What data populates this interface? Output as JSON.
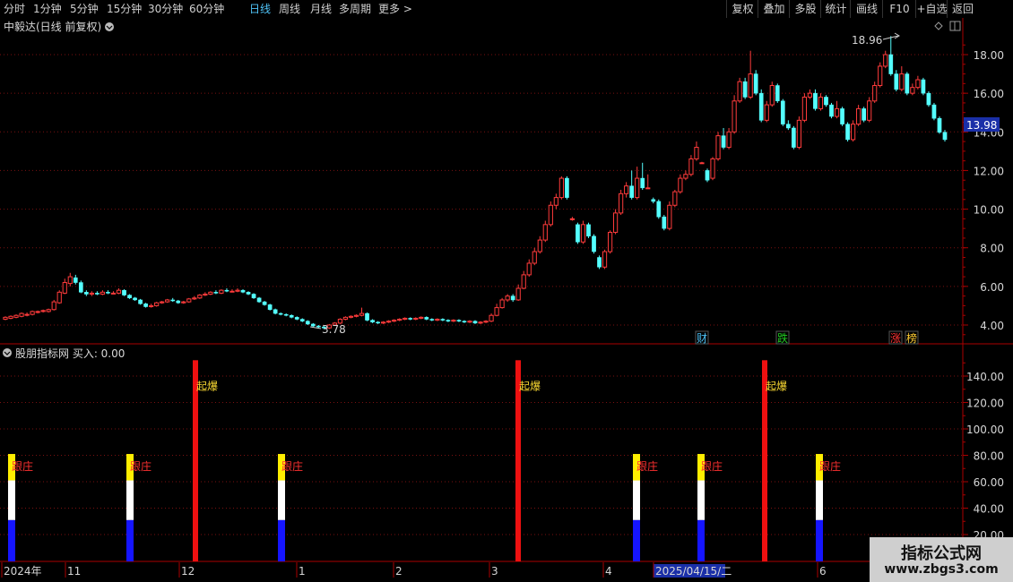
{
  "toolbar": {
    "periods": [
      "分时",
      "1分钟",
      "5分钟",
      "15分钟",
      "30分钟",
      "60分钟",
      "日线",
      "周线",
      "月线",
      "多周期",
      "更多 >"
    ],
    "active_period": "日线",
    "right_buttons": [
      "复权",
      "叠加",
      "多股",
      "统计",
      "画线",
      "F10",
      "+自选",
      "返回"
    ]
  },
  "main_panel": {
    "title": "中毅达(日线 前复权)",
    "high_label": "18.96",
    "low_label": "3.78",
    "current_price": "13.98",
    "y_ticks": [
      "18.00",
      "16.00",
      "14.00",
      "12.00",
      "10.00",
      "8.00",
      "6.00",
      "4.00"
    ],
    "event_tags": [
      {
        "text": "财",
        "color": "#4fc3f7"
      },
      {
        "text": "跌",
        "color": "#22cc22"
      },
      {
        "text": "涨",
        "color": "#ff3333"
      },
      {
        "text": "榜",
        "color": "#ffcc33"
      }
    ],
    "colors": {
      "up": "#ff3b3b",
      "down": "#54ffff",
      "grid": "#7a1111",
      "axis": "#aa0000"
    }
  },
  "indicator_panel": {
    "title": "股朋指标网 买入: 0.00",
    "y_ticks": [
      "140.00",
      "120.00",
      "100.00",
      "80.00",
      "60.00",
      "40.00",
      "20.00"
    ],
    "signal_labels": {
      "short": "跟庄",
      "tall": "起爆"
    }
  },
  "time_axis": {
    "labels": [
      "2024年",
      "11",
      "12",
      "1",
      "2",
      "3",
      "4",
      "2025/04/15/二",
      "6"
    ]
  },
  "chart_data": {
    "type": "candlestick",
    "y_range": [
      3.2,
      19.5
    ],
    "candles": [
      [
        4.3,
        4.4,
        4.25,
        4.45
      ],
      [
        4.35,
        4.45,
        4.3,
        4.5
      ],
      [
        4.4,
        4.5,
        4.35,
        4.55
      ],
      [
        4.45,
        4.6,
        4.4,
        4.65
      ],
      [
        4.55,
        4.55,
        4.45,
        4.65
      ],
      [
        4.55,
        4.7,
        4.5,
        4.75
      ],
      [
        4.65,
        4.7,
        4.6,
        4.75
      ],
      [
        4.7,
        4.75,
        4.65,
        4.8
      ],
      [
        4.7,
        4.8,
        4.65,
        4.85
      ],
      [
        4.8,
        5.2,
        4.75,
        5.3
      ],
      [
        5.15,
        5.7,
        5.1,
        5.8
      ],
      [
        5.65,
        6.2,
        5.6,
        6.4
      ],
      [
        6.15,
        6.5,
        6.0,
        6.7
      ],
      [
        6.45,
        6.2,
        6.1,
        6.6
      ],
      [
        6.2,
        5.7,
        5.65,
        6.3
      ],
      [
        5.7,
        5.6,
        5.5,
        5.8
      ],
      [
        5.6,
        5.65,
        5.5,
        5.75
      ],
      [
        5.65,
        5.6,
        5.55,
        5.75
      ],
      [
        5.6,
        5.7,
        5.55,
        5.8
      ],
      [
        5.7,
        5.65,
        5.6,
        5.8
      ],
      [
        5.65,
        5.65,
        5.6,
        5.75
      ],
      [
        5.65,
        5.8,
        5.6,
        5.9
      ],
      [
        5.8,
        5.55,
        5.5,
        5.85
      ],
      [
        5.55,
        5.4,
        5.35,
        5.6
      ],
      [
        5.4,
        5.3,
        5.25,
        5.45
      ],
      [
        5.3,
        5.1,
        5.05,
        5.35
      ],
      [
        5.1,
        4.95,
        4.9,
        5.15
      ],
      [
        4.95,
        5.0,
        4.9,
        5.1
      ],
      [
        5.0,
        5.15,
        4.95,
        5.2
      ],
      [
        5.15,
        5.2,
        5.1,
        5.25
      ],
      [
        5.2,
        5.3,
        5.15,
        5.35
      ],
      [
        5.3,
        5.25,
        5.2,
        5.4
      ],
      [
        5.25,
        5.15,
        5.1,
        5.3
      ],
      [
        5.15,
        5.2,
        5.1,
        5.25
      ],
      [
        5.2,
        5.35,
        5.15,
        5.4
      ],
      [
        5.35,
        5.4,
        5.3,
        5.5
      ],
      [
        5.4,
        5.55,
        5.35,
        5.6
      ],
      [
        5.55,
        5.6,
        5.5,
        5.7
      ],
      [
        5.6,
        5.7,
        5.55,
        5.75
      ],
      [
        5.7,
        5.65,
        5.6,
        5.8
      ],
      [
        5.65,
        5.8,
        5.6,
        5.85
      ],
      [
        5.8,
        5.75,
        5.7,
        5.9
      ],
      [
        5.75,
        5.75,
        5.7,
        5.85
      ],
      [
        5.75,
        5.8,
        5.7,
        5.9
      ],
      [
        5.8,
        5.7,
        5.65,
        5.85
      ],
      [
        5.7,
        5.6,
        5.55,
        5.75
      ],
      [
        5.6,
        5.4,
        5.35,
        5.65
      ],
      [
        5.4,
        5.2,
        5.15,
        5.45
      ],
      [
        5.2,
        5.05,
        5.0,
        5.25
      ],
      [
        5.05,
        4.8,
        4.75,
        5.1
      ],
      [
        4.8,
        4.6,
        4.55,
        4.85
      ],
      [
        4.6,
        4.55,
        4.5,
        4.65
      ],
      [
        4.55,
        4.5,
        4.45,
        4.6
      ],
      [
        4.5,
        4.4,
        4.35,
        4.55
      ],
      [
        4.4,
        4.3,
        4.25,
        4.45
      ],
      [
        4.3,
        4.2,
        4.15,
        4.35
      ],
      [
        4.2,
        4.05,
        4.0,
        4.25
      ],
      [
        4.05,
        3.95,
        3.9,
        4.1
      ],
      [
        3.95,
        3.9,
        3.85,
        4.0
      ],
      [
        3.9,
        3.85,
        3.78,
        3.95
      ],
      [
        3.85,
        4.0,
        3.8,
        4.05
      ],
      [
        4.0,
        4.1,
        3.95,
        4.15
      ],
      [
        4.1,
        4.3,
        4.05,
        4.35
      ],
      [
        4.3,
        4.4,
        4.25,
        4.45
      ],
      [
        4.4,
        4.45,
        4.35,
        4.5
      ],
      [
        4.45,
        4.5,
        4.4,
        4.55
      ],
      [
        4.5,
        4.6,
        4.45,
        4.9
      ],
      [
        4.6,
        4.25,
        4.2,
        4.65
      ],
      [
        4.25,
        4.15,
        4.1,
        4.3
      ],
      [
        4.15,
        4.1,
        4.05,
        4.2
      ],
      [
        4.1,
        4.15,
        4.05,
        4.2
      ],
      [
        4.15,
        4.2,
        4.1,
        4.25
      ],
      [
        4.2,
        4.25,
        4.15,
        4.3
      ],
      [
        4.25,
        4.3,
        4.2,
        4.35
      ],
      [
        4.3,
        4.35,
        4.25,
        4.4
      ],
      [
        4.35,
        4.3,
        4.25,
        4.4
      ],
      [
        4.3,
        4.35,
        4.25,
        4.4
      ],
      [
        4.35,
        4.4,
        4.3,
        4.45
      ],
      [
        4.4,
        4.3,
        4.25,
        4.45
      ],
      [
        4.3,
        4.25,
        4.2,
        4.35
      ],
      [
        4.25,
        4.3,
        4.2,
        4.35
      ],
      [
        4.3,
        4.25,
        4.2,
        4.35
      ],
      [
        4.25,
        4.2,
        4.15,
        4.3
      ],
      [
        4.2,
        4.25,
        4.15,
        4.3
      ],
      [
        4.25,
        4.2,
        4.15,
        4.3
      ],
      [
        4.2,
        4.15,
        4.1,
        4.25
      ],
      [
        4.15,
        4.2,
        4.1,
        4.25
      ],
      [
        4.2,
        4.1,
        4.05,
        4.25
      ],
      [
        4.1,
        4.15,
        4.05,
        4.2
      ],
      [
        4.15,
        4.2,
        4.1,
        4.25
      ],
      [
        4.2,
        4.5,
        4.15,
        4.6
      ],
      [
        4.5,
        4.9,
        4.45,
        5.1
      ],
      [
        4.9,
        5.3,
        4.85,
        5.4
      ],
      [
        5.3,
        5.5,
        5.2,
        5.6
      ],
      [
        5.5,
        5.3,
        5.2,
        5.6
      ],
      [
        5.3,
        5.9,
        5.25,
        6.1
      ],
      [
        5.9,
        6.6,
        5.85,
        6.8
      ],
      [
        6.6,
        7.2,
        6.5,
        7.4
      ],
      [
        7.2,
        7.8,
        7.1,
        8.0
      ],
      [
        7.8,
        8.4,
        7.7,
        8.6
      ],
      [
        8.4,
        9.2,
        8.3,
        9.4
      ],
      [
        9.2,
        10.2,
        9.1,
        10.4
      ],
      [
        10.2,
        10.6,
        10.0,
        10.8
      ],
      [
        10.6,
        11.6,
        10.5,
        11.7
      ],
      [
        11.6,
        10.6,
        10.5,
        11.7
      ],
      [
        9.5,
        9.5,
        9.4,
        9.6
      ],
      [
        9.2,
        8.3,
        8.2,
        9.3
      ],
      [
        8.3,
        9.2,
        8.2,
        9.4
      ],
      [
        9.2,
        8.6,
        8.5,
        9.3
      ],
      [
        8.6,
        7.8,
        7.7,
        8.7
      ],
      [
        7.5,
        7.0,
        6.9,
        7.6
      ],
      [
        7.0,
        7.8,
        6.9,
        7.9
      ],
      [
        7.8,
        8.8,
        7.7,
        8.9
      ],
      [
        8.8,
        9.8,
        8.7,
        10.0
      ],
      [
        9.8,
        10.8,
        9.7,
        11.0
      ],
      [
        10.8,
        11.2,
        10.6,
        11.4
      ],
      [
        11.2,
        10.6,
        10.5,
        12.0
      ],
      [
        10.6,
        11.6,
        10.5,
        12.2
      ],
      [
        11.6,
        11.1,
        11.0,
        12.4
      ],
      [
        11.1,
        11.1,
        11.05,
        11.8
      ],
      [
        10.5,
        10.4,
        10.3,
        10.6
      ],
      [
        10.4,
        9.6,
        9.5,
        10.5
      ],
      [
        9.6,
        9.0,
        8.9,
        9.7
      ],
      [
        9.0,
        10.2,
        8.9,
        10.4
      ],
      [
        10.2,
        10.9,
        10.1,
        11.0
      ],
      [
        10.9,
        11.6,
        10.8,
        11.8
      ],
      [
        11.6,
        11.8,
        11.5,
        12.0
      ],
      [
        11.8,
        12.6,
        11.7,
        12.8
      ],
      [
        12.6,
        13.2,
        12.5,
        13.5
      ],
      [
        12.4,
        12.4,
        12.35,
        12.45
      ],
      [
        12.0,
        11.5,
        11.4,
        12.1
      ],
      [
        11.6,
        12.6,
        11.5,
        12.7
      ],
      [
        12.6,
        13.8,
        12.5,
        14.0
      ],
      [
        13.8,
        13.2,
        13.1,
        14.2
      ],
      [
        13.2,
        14.0,
        13.1,
        14.2
      ],
      [
        14.0,
        15.6,
        13.9,
        15.9
      ],
      [
        15.6,
        16.6,
        15.5,
        16.8
      ],
      [
        16.6,
        15.8,
        15.7,
        16.8
      ],
      [
        15.8,
        17.0,
        15.7,
        18.2
      ],
      [
        17.0,
        16.0,
        15.9,
        17.2
      ],
      [
        16.0,
        14.6,
        14.5,
        16.2
      ],
      [
        14.6,
        15.4,
        14.5,
        15.6
      ],
      [
        15.4,
        16.4,
        15.3,
        16.6
      ],
      [
        16.4,
        15.6,
        15.5,
        16.5
      ],
      [
        15.6,
        14.4,
        14.3,
        15.7
      ],
      [
        14.4,
        14.2,
        14.1,
        14.6
      ],
      [
        14.2,
        13.2,
        13.1,
        14.3
      ],
      [
        13.2,
        14.6,
        13.1,
        14.8
      ],
      [
        14.6,
        15.8,
        14.5,
        16.0
      ],
      [
        15.8,
        16.0,
        15.7,
        16.2
      ],
      [
        16.0,
        15.2,
        15.1,
        16.2
      ],
      [
        15.2,
        15.8,
        15.1,
        16.0
      ],
      [
        15.8,
        15.4,
        15.3,
        15.9
      ],
      [
        15.4,
        14.8,
        14.7,
        15.5
      ],
      [
        14.8,
        15.2,
        14.7,
        15.6
      ],
      [
        15.2,
        14.4,
        14.3,
        15.3
      ],
      [
        14.4,
        13.6,
        13.5,
        14.5
      ],
      [
        13.6,
        14.4,
        13.5,
        14.6
      ],
      [
        14.4,
        15.2,
        14.3,
        15.4
      ],
      [
        15.2,
        14.6,
        14.5,
        15.3
      ],
      [
        14.6,
        15.6,
        14.5,
        15.8
      ],
      [
        15.6,
        16.4,
        15.5,
        16.6
      ],
      [
        16.4,
        17.4,
        16.3,
        17.6
      ],
      [
        17.4,
        18.0,
        17.3,
        18.2
      ],
      [
        18.0,
        17.0,
        16.9,
        18.96
      ],
      [
        17.0,
        16.2,
        16.1,
        17.2
      ],
      [
        16.2,
        17.0,
        16.1,
        17.4
      ],
      [
        17.0,
        16.0,
        15.9,
        17.1
      ],
      [
        16.0,
        16.3,
        15.9,
        16.5
      ],
      [
        16.3,
        16.7,
        16.2,
        16.9
      ],
      [
        16.7,
        16.0,
        15.9,
        16.8
      ],
      [
        16.0,
        15.4,
        15.3,
        16.1
      ],
      [
        15.4,
        14.7,
        14.6,
        15.5
      ],
      [
        14.7,
        13.98,
        13.9,
        14.8
      ],
      [
        13.98,
        13.6,
        13.5,
        14.1
      ]
    ],
    "indicator": {
      "short_bars": [
        13,
        145,
        314,
        710,
        782,
        914
      ],
      "tall_bars": [
        218,
        578,
        853
      ],
      "tall_value": 152,
      "short_value": 81,
      "y_range": [
        0,
        155
      ]
    }
  }
}
